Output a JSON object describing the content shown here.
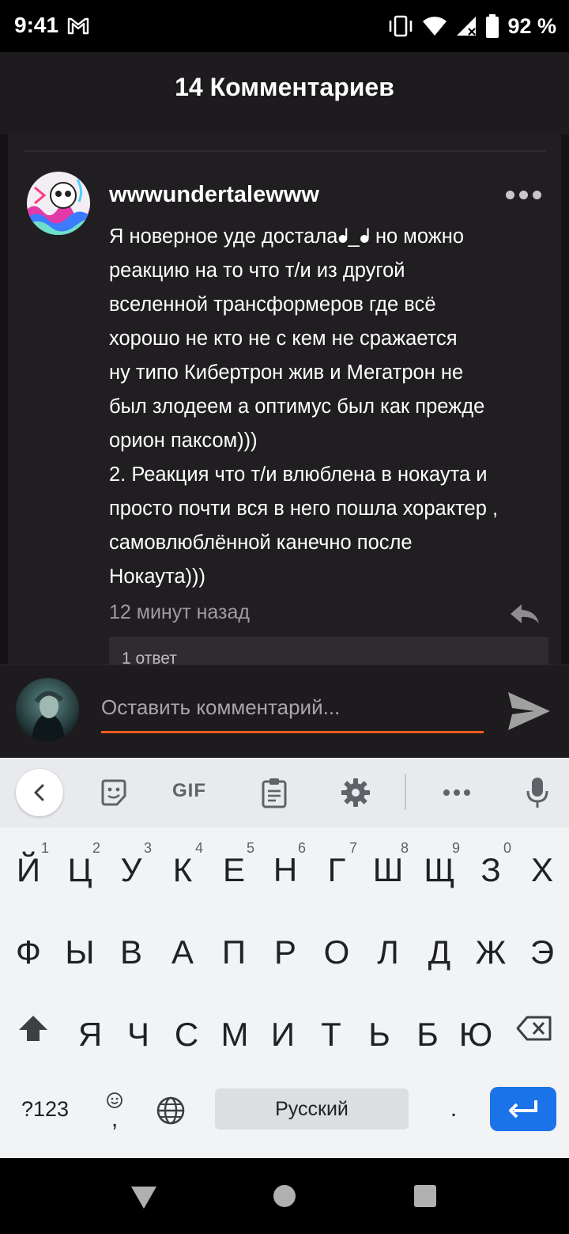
{
  "status_bar": {
    "time": "9:41",
    "battery_percent": "92 %",
    "icons": [
      "gmail-icon",
      "vibrate-icon",
      "wifi-icon",
      "signal-icon",
      "battery-icon"
    ]
  },
  "header": {
    "title": "14 Комментариев"
  },
  "comment": {
    "username": "wwwundertalewww",
    "text_lines": [
      "Я новерное уде досталаᖱ_ᖱ но можно",
      "реакцию на то что т/и из другой",
      "вселенной трансформеров где всё",
      "хорошо не кто не с кем не сражается",
      "ну типо Кибертрон жив и Мегатрон не",
      "был злодеем а оптимус был как прежде",
      "орион паксом)))",
      "2. Реакция что т/и влюблена в нокаута и",
      "просто почти вся в него пошла хорактер ,",
      "самовлюблённой канечно после",
      "Нокаута)))"
    ],
    "time_ago": "12 минут назад",
    "replies_label": "1 ответ"
  },
  "input": {
    "placeholder": "Оставить комментарий..."
  },
  "keyboard": {
    "toolbar": {
      "gif_label": "GIF"
    },
    "row1": [
      {
        "ch": "Й",
        "hint": "1"
      },
      {
        "ch": "Ц",
        "hint": "2"
      },
      {
        "ch": "У",
        "hint": "3"
      },
      {
        "ch": "К",
        "hint": "4"
      },
      {
        "ch": "Е",
        "hint": "5"
      },
      {
        "ch": "Н",
        "hint": "6"
      },
      {
        "ch": "Г",
        "hint": "7"
      },
      {
        "ch": "Ш",
        "hint": "8"
      },
      {
        "ch": "Щ",
        "hint": "9"
      },
      {
        "ch": "З",
        "hint": "0"
      },
      {
        "ch": "Х",
        "hint": ""
      }
    ],
    "row2": [
      "Ф",
      "Ы",
      "В",
      "А",
      "П",
      "Р",
      "О",
      "Л",
      "Д",
      "Ж",
      "Э"
    ],
    "row3": [
      "Я",
      "Ч",
      "С",
      "М",
      "И",
      "Т",
      "Ь",
      "Б",
      "Ю"
    ],
    "symbols_label": "?123",
    "comma_label": ",",
    "space_label": "Русский",
    "period_label": ".",
    "colors": {
      "enter": "#1a73e8",
      "accent": "#ef5a1f"
    }
  }
}
